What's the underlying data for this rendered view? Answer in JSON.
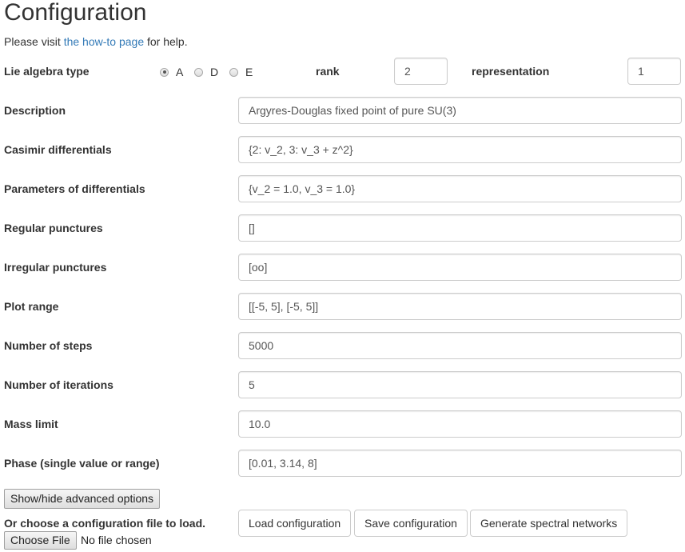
{
  "page": {
    "title": "Configuration",
    "help_prefix": "Please visit ",
    "help_link": "the how-to page",
    "help_suffix": " for help."
  },
  "lie_algebra": {
    "label": "Lie algebra type",
    "options": [
      {
        "label": "A",
        "checked": true
      },
      {
        "label": "D",
        "checked": false
      },
      {
        "label": "E",
        "checked": false
      }
    ],
    "rank_label": "rank",
    "rank_value": "2",
    "representation_label": "representation",
    "representation_value": "1"
  },
  "fields": [
    {
      "label": "Description",
      "value": "Argyres-Douglas fixed point of pure SU(3)"
    },
    {
      "label": "Casimir differentials",
      "value": "{2: v_2, 3: v_3 + z^2}"
    },
    {
      "label": "Parameters of differentials",
      "value": "{v_2 = 1.0, v_3 = 1.0}"
    },
    {
      "label": "Regular punctures",
      "value": "[]"
    },
    {
      "label": "Irregular punctures",
      "value": "[oo]"
    },
    {
      "label": "Plot range",
      "value": "[[-5, 5], [-5, 5]]"
    },
    {
      "label": "Number of steps",
      "value": "5000"
    },
    {
      "label": "Number of iterations",
      "value": "5"
    },
    {
      "label": "Mass limit",
      "value": "10.0"
    },
    {
      "label": "Phase (single value or range)",
      "value": "[0.01, 3.14, 8]"
    }
  ],
  "buttons": {
    "advanced": "Show/hide advanced options",
    "file_prompt": "Or choose a configuration file to load.",
    "choose_file": "Choose File",
    "no_file": "No file chosen",
    "load": "Load configuration",
    "save": "Save configuration",
    "generate": "Generate spectral networks"
  },
  "colors": {
    "link": "#337ab7",
    "text": "#333333"
  }
}
